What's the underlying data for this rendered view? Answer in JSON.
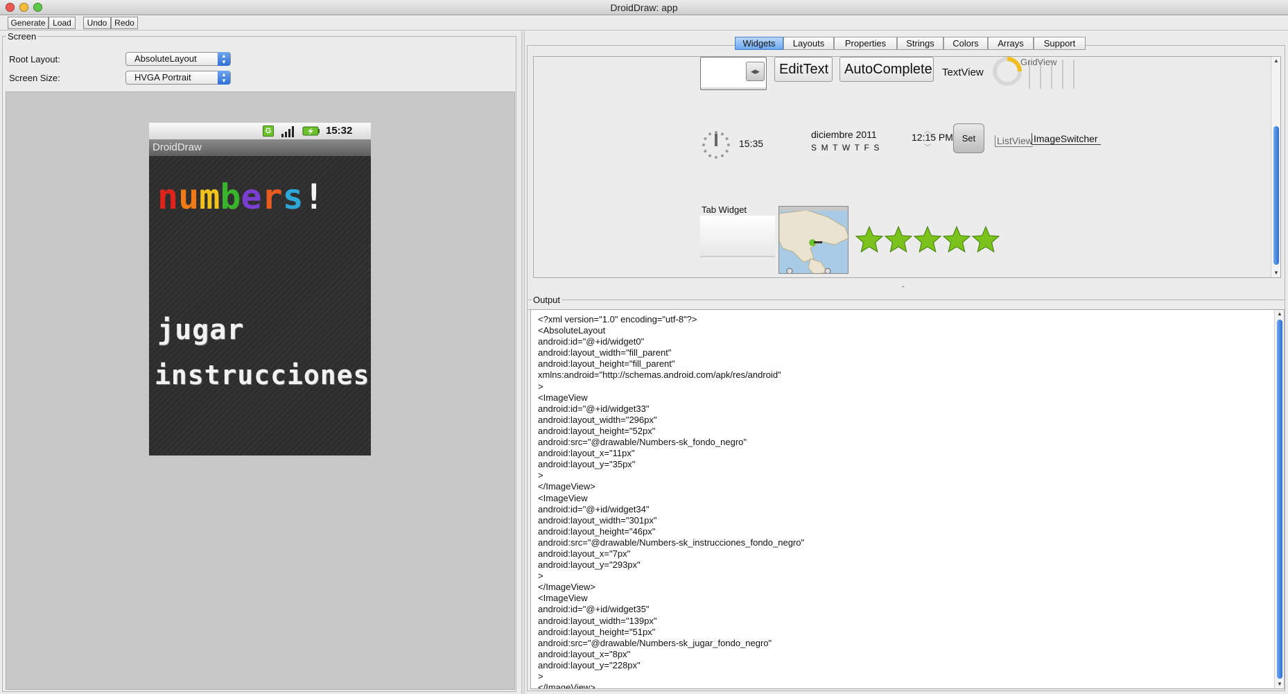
{
  "window": {
    "title": "DroidDraw: app"
  },
  "toolbar": {
    "generate": "Generate",
    "load": "Load",
    "undo": "Undo",
    "redo": "Redo"
  },
  "screen": {
    "legend": "Screen",
    "root_layout_label": "Root Layout:",
    "root_layout_value": "AbsoluteLayout",
    "screen_size_label": "Screen Size:",
    "screen_size_value": "HVGA Portrait"
  },
  "phone": {
    "status_time": "15:32",
    "app_title": "DroidDraw",
    "logo_letters": [
      "n",
      "u",
      "m",
      "b",
      "e",
      "r",
      "s",
      "!"
    ],
    "logo_colors": [
      "#e0231b",
      "#f07b16",
      "#f2c21a",
      "#39b32e",
      "#7a3fd0",
      "#e85a1f",
      "#2ca7d8",
      "#f4f4f4"
    ],
    "jugar": "jugar",
    "instrucciones": "instrucciones"
  },
  "tabs": [
    "Widgets",
    "Layouts",
    "Properties",
    "Strings",
    "Colors",
    "Arrays",
    "Support"
  ],
  "selected_tab": "Widgets",
  "widgets": {
    "edittext": "EditText",
    "autocomplete": "AutoComplete",
    "textview": "TextView",
    "gridview": "GridView",
    "analog_time": "15:35",
    "date_month": "diciembre 2011",
    "weekdays": "S  M  T  W  T  F  S",
    "time_picker": "12:15 PM",
    "set_button": "Set",
    "listview": "ListView",
    "imageswitcher": "ImageSwitcher",
    "tab_widget": "Tab Widget",
    "rating_stars": 5
  },
  "output": {
    "legend": "Output",
    "lines": [
      "<?xml version=\"1.0\" encoding=\"utf-8\"?>",
      "<AbsoluteLayout",
      "android:id=\"@+id/widget0\"",
      "android:layout_width=\"fill_parent\"",
      "android:layout_height=\"fill_parent\"",
      "xmlns:android=\"http://schemas.android.com/apk/res/android\"",
      ">",
      "<ImageView",
      "android:id=\"@+id/widget33\"",
      "android:layout_width=\"296px\"",
      "android:layout_height=\"52px\"",
      "android:src=\"@drawable/Numbers-sk_fondo_negro\"",
      "android:layout_x=\"11px\"",
      "android:layout_y=\"35px\"",
      ">",
      "</ImageView>",
      "<ImageView",
      "android:id=\"@+id/widget34\"",
      "android:layout_width=\"301px\"",
      "android:layout_height=\"46px\"",
      "android:src=\"@drawable/Numbers-sk_instrucciones_fondo_negro\"",
      "android:layout_x=\"7px\"",
      "android:layout_y=\"293px\"",
      ">",
      "</ImageView>",
      "<ImageView",
      "android:id=\"@+id/widget35\"",
      "android:layout_width=\"139px\"",
      "android:layout_height=\"51px\"",
      "android:src=\"@drawable/Numbers-sk_jugar_fondo_negro\"",
      "android:layout_x=\"8px\"",
      "android:layout_y=\"228px\"",
      ">",
      "</ImageView>"
    ]
  }
}
